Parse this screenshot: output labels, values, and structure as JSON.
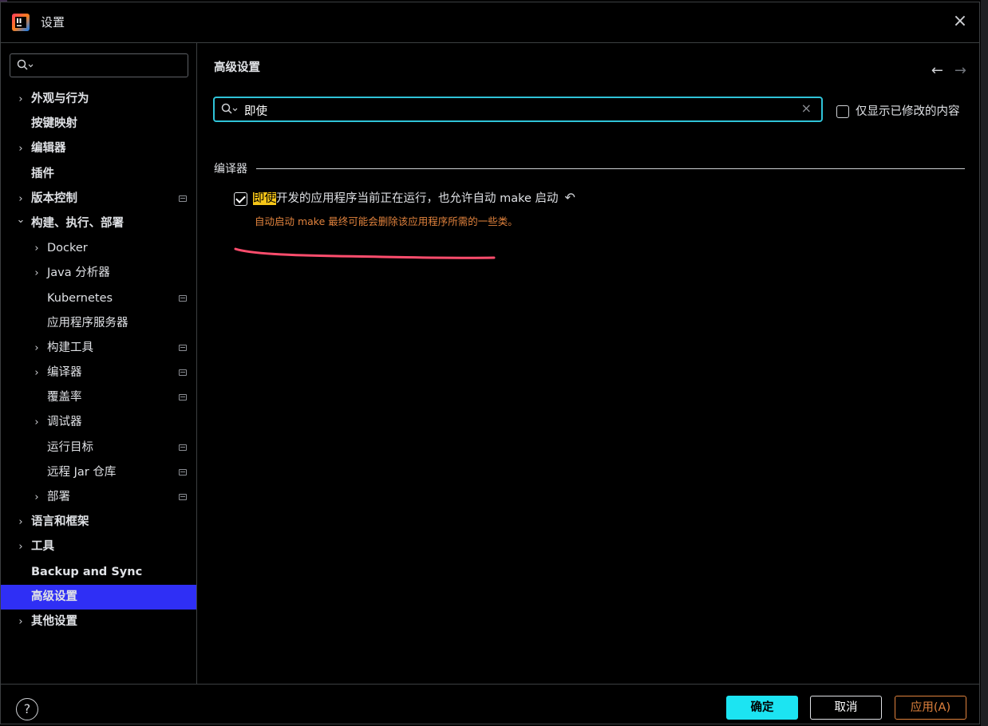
{
  "window": {
    "title": "设置",
    "close_icon": "×"
  },
  "sidebar": {
    "search_placeholder": "",
    "items": [
      {
        "label": "外观与行为",
        "level": 0,
        "expandable": true,
        "expanded": false,
        "bold": true,
        "pinned": false,
        "selected": false
      },
      {
        "label": "按键映射",
        "level": 0,
        "expandable": false,
        "bold": true,
        "pinned": false,
        "selected": false
      },
      {
        "label": "编辑器",
        "level": 0,
        "expandable": true,
        "expanded": false,
        "bold": true,
        "pinned": false,
        "selected": false
      },
      {
        "label": "插件",
        "level": 0,
        "expandable": false,
        "bold": true,
        "pinned": false,
        "selected": false
      },
      {
        "label": "版本控制",
        "level": 0,
        "expandable": true,
        "expanded": false,
        "bold": true,
        "pinned": true,
        "selected": false
      },
      {
        "label": "构建、执行、部署",
        "level": 0,
        "expandable": true,
        "expanded": true,
        "bold": true,
        "pinned": false,
        "selected": false
      },
      {
        "label": "Docker",
        "level": 1,
        "expandable": true,
        "expanded": false,
        "bold": false,
        "pinned": false,
        "selected": false
      },
      {
        "label": "Java 分析器",
        "level": 1,
        "expandable": true,
        "expanded": false,
        "bold": false,
        "pinned": false,
        "selected": false
      },
      {
        "label": "Kubernetes",
        "level": 1,
        "expandable": false,
        "bold": false,
        "pinned": true,
        "selected": false
      },
      {
        "label": "应用程序服务器",
        "level": 1,
        "expandable": false,
        "bold": false,
        "pinned": false,
        "selected": false
      },
      {
        "label": "构建工具",
        "level": 1,
        "expandable": true,
        "expanded": false,
        "bold": false,
        "pinned": true,
        "selected": false
      },
      {
        "label": "编译器",
        "level": 1,
        "expandable": true,
        "expanded": false,
        "bold": false,
        "pinned": true,
        "selected": false
      },
      {
        "label": "覆盖率",
        "level": 1,
        "expandable": false,
        "bold": false,
        "pinned": true,
        "selected": false
      },
      {
        "label": "调试器",
        "level": 1,
        "expandable": true,
        "expanded": false,
        "bold": false,
        "pinned": false,
        "selected": false
      },
      {
        "label": "运行目标",
        "level": 1,
        "expandable": false,
        "bold": false,
        "pinned": true,
        "selected": false
      },
      {
        "label": "远程 Jar 仓库",
        "level": 1,
        "expandable": false,
        "bold": false,
        "pinned": true,
        "selected": false
      },
      {
        "label": "部署",
        "level": 1,
        "expandable": true,
        "expanded": false,
        "bold": false,
        "pinned": true,
        "selected": false
      },
      {
        "label": "语言和框架",
        "level": 0,
        "expandable": true,
        "expanded": false,
        "bold": true,
        "pinned": false,
        "selected": false
      },
      {
        "label": "工具",
        "level": 0,
        "expandable": true,
        "expanded": false,
        "bold": true,
        "pinned": false,
        "selected": false
      },
      {
        "label": "Backup and Sync",
        "level": 0,
        "expandable": false,
        "bold": true,
        "pinned": false,
        "selected": false
      },
      {
        "label": "高级设置",
        "level": 0,
        "expandable": false,
        "bold": true,
        "pinned": false,
        "selected": true
      },
      {
        "label": "其他设置",
        "level": 0,
        "expandable": true,
        "expanded": false,
        "bold": true,
        "pinned": false,
        "selected": false
      }
    ]
  },
  "content": {
    "title": "高级设置",
    "nav_back_icon": "←",
    "nav_forward_icon": "→",
    "search_value": "即使",
    "clear_icon": "×",
    "modified_only_label": "仅显示已修改的内容",
    "modified_only_checked": false,
    "group_header": "编译器",
    "option": {
      "highlight": "即使",
      "rest": "开发的应用程序当前正在运行，也允许自动 make 启动",
      "checked": true,
      "reset_icon": "↶",
      "note": "自动启动 make 最终可能会删除该应用程序所需的一些类。"
    }
  },
  "footer": {
    "help_icon": "?",
    "ok_label": "确定",
    "cancel_label": "取消",
    "apply_label": "应用(A)"
  },
  "colors": {
    "background": "#000000",
    "selection": "#2f2ff5",
    "search_focus": "#2fc3d8",
    "ok_button": "#1ce4f2",
    "warning_text": "#e0823d",
    "search_highlight": "#f5c518",
    "annotation_stroke": "#ff4d6d"
  }
}
